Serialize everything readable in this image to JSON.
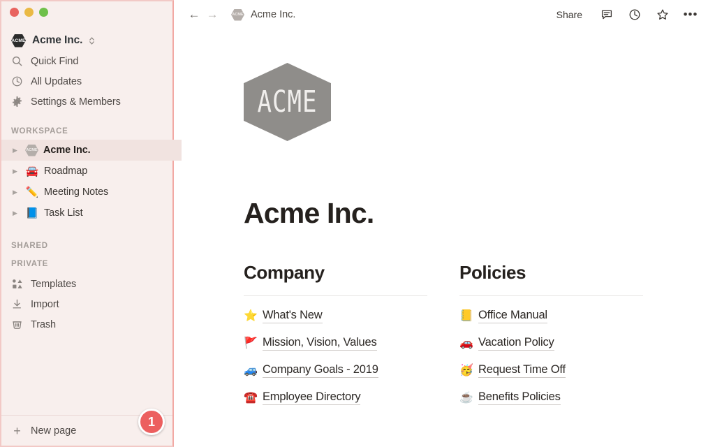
{
  "window": {
    "traffic_lights": [
      {
        "name": "close",
        "color": "#e8635f"
      },
      {
        "name": "minimize",
        "color": "#eab944"
      },
      {
        "name": "zoom",
        "color": "#6fc04a"
      }
    ]
  },
  "sidebar": {
    "workspace_switcher": {
      "logo_text": "ACME",
      "name": "Acme Inc.",
      "chevron": "⌃⌄"
    },
    "nav": [
      {
        "icon": "search-icon",
        "label": "Quick Find"
      },
      {
        "icon": "clock-icon",
        "label": "All Updates"
      },
      {
        "icon": "gear-icon",
        "label": "Settings & Members"
      }
    ],
    "sections": {
      "workspace_label": "WORKSPACE",
      "shared_label": "SHARED",
      "private_label": "PRIVATE"
    },
    "workspace_pages": [
      {
        "icon": "acme-hex-icon",
        "icon_text": "ACME",
        "label": "Acme Inc.",
        "selected": true,
        "arrow": "▶"
      },
      {
        "icon": "car-emoji",
        "emoji": "🚘",
        "label": "Roadmap",
        "selected": false,
        "arrow": "▶"
      },
      {
        "icon": "pencil-emoji",
        "emoji": "✏️",
        "label": "Meeting Notes",
        "selected": false,
        "arrow": "▶"
      },
      {
        "icon": "book-emoji",
        "emoji": "📘",
        "label": "Task List",
        "selected": false,
        "arrow": "▶"
      }
    ],
    "utility": [
      {
        "icon": "templates-icon",
        "label": "Templates"
      },
      {
        "icon": "import-icon",
        "label": "Import"
      },
      {
        "icon": "trash-icon",
        "label": "Trash"
      }
    ],
    "new_page": {
      "icon": "plus-icon",
      "label": "New page"
    },
    "badge": {
      "count": "1",
      "color": "#ec5f5f"
    }
  },
  "topbar": {
    "back": "←",
    "forward": "→",
    "breadcrumb_logo_text": "ACME",
    "breadcrumb_title": "Acme Inc.",
    "share_label": "Share",
    "icons": [
      {
        "name": "comment-icon"
      },
      {
        "name": "history-clock-icon"
      },
      {
        "name": "star-icon"
      },
      {
        "name": "more-options-icon",
        "glyph": "•••"
      }
    ]
  },
  "document": {
    "cover_logo_text": "ACME",
    "title": "Acme Inc.",
    "columns": [
      {
        "heading": "Company",
        "links": [
          {
            "emoji": "⭐",
            "emoji_name": "star-emoji",
            "label": "What's New"
          },
          {
            "emoji": "🚩",
            "emoji_name": "triangular-flag-emoji",
            "label": "Mission, Vision, Values"
          },
          {
            "emoji": "🚙",
            "emoji_name": "recreational-vehicle-emoji",
            "label": "Company Goals - 2019"
          },
          {
            "emoji": "☎️",
            "emoji_name": "telephone-emoji",
            "label": "Employee Directory"
          }
        ]
      },
      {
        "heading": "Policies",
        "links": [
          {
            "emoji": "📒",
            "emoji_name": "ledger-emoji",
            "label": "Office Manual"
          },
          {
            "emoji": "🚗",
            "emoji_name": "automobile-emoji",
            "label": "Vacation Policy"
          },
          {
            "emoji": "🥳",
            "emoji_name": "partying-face-emoji",
            "label": "Request Time Off"
          },
          {
            "emoji": "☕",
            "emoji_name": "hot-beverage-emoji",
            "label": "Benefits Policies"
          }
        ]
      }
    ]
  }
}
